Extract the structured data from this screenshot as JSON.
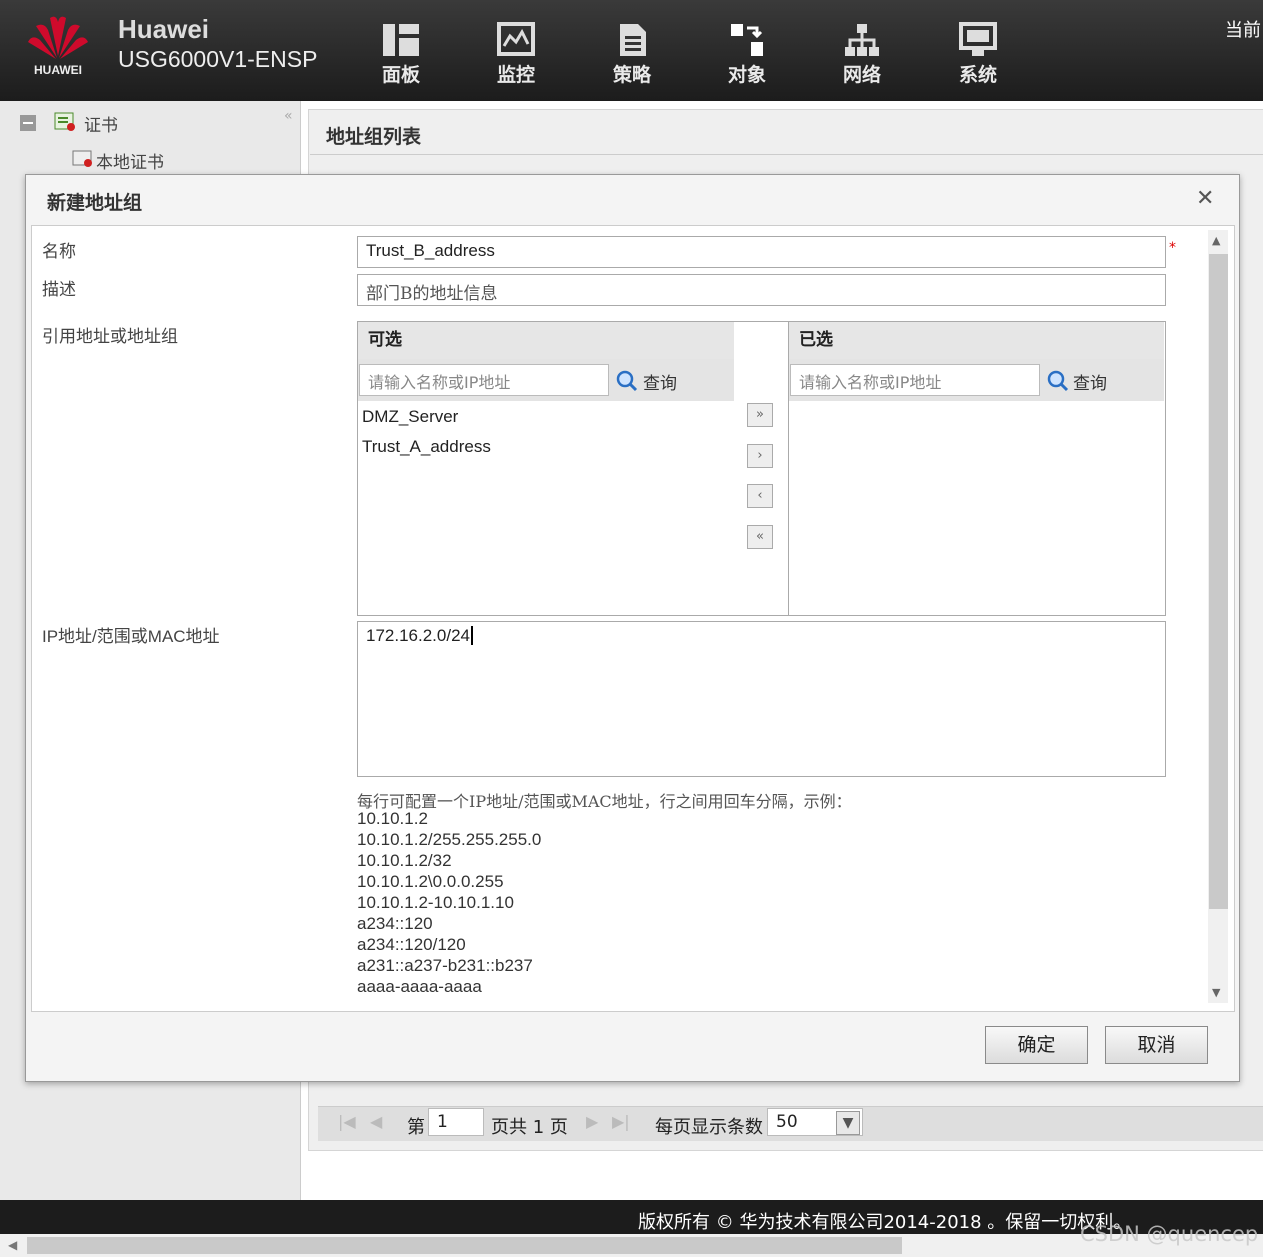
{
  "header": {
    "logo_text": "HUAWEI",
    "brand": "Huawei",
    "model": "USG6000V1-ENSP",
    "current_text": "当前",
    "nav": [
      {
        "label": "面板",
        "icon": "dashboard-icon"
      },
      {
        "label": "监控",
        "icon": "monitor-icon"
      },
      {
        "label": "策略",
        "icon": "policy-icon"
      },
      {
        "label": "对象",
        "icon": "object-icon"
      },
      {
        "label": "网络",
        "icon": "network-icon"
      },
      {
        "label": "系统",
        "icon": "system-icon"
      }
    ]
  },
  "sidebar": {
    "items": [
      {
        "label": "证书",
        "icon": "certificate-icon"
      },
      {
        "label": "本地证书",
        "icon": "local-certificate-icon"
      }
    ]
  },
  "main": {
    "title": "地址组列表"
  },
  "dialog": {
    "title": "新建地址组",
    "name_label": "名称",
    "name_value": "Trust_B_address",
    "required_mark": "*",
    "desc_label": "描述",
    "desc_value": "部门B的地址信息",
    "ref_label": "引用地址或地址组",
    "available": {
      "header": "可选",
      "placeholder": "请输入名称或IP地址",
      "search_label": "查询",
      "items": [
        "DMZ_Server",
        "Trust_A_address"
      ]
    },
    "selected": {
      "header": "已选",
      "placeholder": "请输入名称或IP地址",
      "search_label": "查询",
      "items": []
    },
    "ip_label": "IP地址/范围或MAC地址",
    "ip_value": "172.16.2.0/24",
    "hint_title": "每行可配置一个IP地址/范围或MAC地址，行之间用回车分隔，示例：",
    "hint_examples": [
      "10.10.1.2",
      "10.10.1.2/255.255.255.0",
      "10.10.1.2/32",
      "10.10.1.2\\0.0.0.255",
      "10.10.1.2-10.10.1.10",
      "a234::120",
      "a234::120/120",
      "a231::a237-b231::b237",
      "aaaa-aaaa-aaaa"
    ],
    "ok_label": "确定",
    "cancel_label": "取消"
  },
  "pager": {
    "page_prefix": "第",
    "page_value": "1",
    "page_total": "页共 1 页",
    "per_page_label": "每页显示条数",
    "per_page_value": "50"
  },
  "footer": {
    "copyright": "版权所有 © 华为技术有限公司2014-2018 。保留一切权利。",
    "watermark": "CSDN @quencep"
  },
  "colors": {
    "huawei_red": "#cf0a2c",
    "header_bg": "#2a2a2a"
  }
}
